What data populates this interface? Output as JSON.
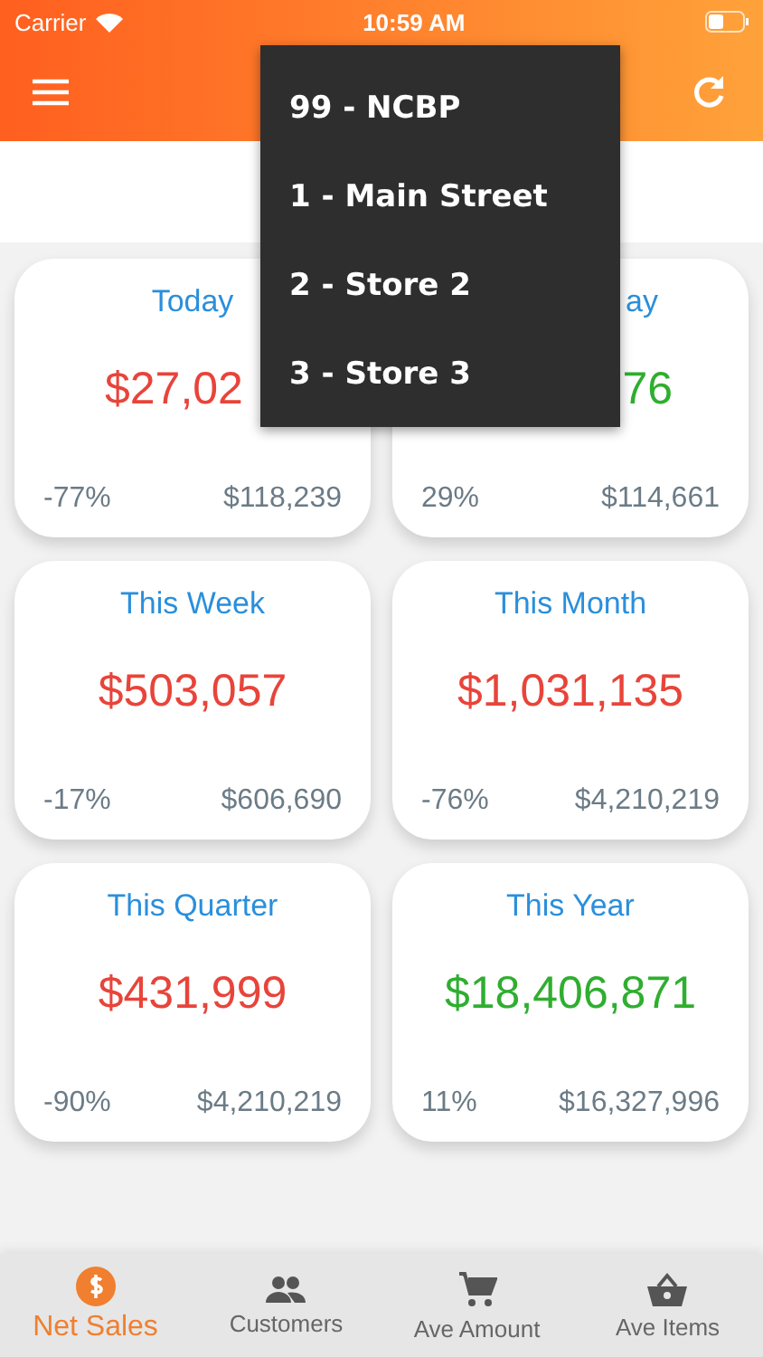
{
  "status_bar": {
    "carrier": "Carrier",
    "time": "10:59 AM"
  },
  "store_menu": {
    "items": [
      {
        "label": "99 - NCBP"
      },
      {
        "label": "1 - Main Street"
      },
      {
        "label": "2 - Store 2"
      },
      {
        "label": "3 - Store 3"
      }
    ]
  },
  "cards": [
    {
      "title": "Today",
      "amount": "$27,02",
      "color": "#e8443a",
      "change": "-77%",
      "previous": "$118,239"
    },
    {
      "title": "ay",
      "amount": "76",
      "color": "#2fae2f",
      "change": "29%",
      "previous": "$114,661"
    },
    {
      "title": "This Week",
      "amount": "$503,057",
      "color": "#e8443a",
      "change": "-17%",
      "previous": "$606,690"
    },
    {
      "title": "This Month",
      "amount": "$1,031,135",
      "color": "#e8443a",
      "change": "-76%",
      "previous": "$4,210,219"
    },
    {
      "title": "This Quarter",
      "amount": "$431,999",
      "color": "#e8443a",
      "change": "-90%",
      "previous": "$4,210,219"
    },
    {
      "title": "This Year",
      "amount": "$18,406,871",
      "color": "#2fae2f",
      "change": "11%",
      "previous": "$16,327,996"
    }
  ],
  "tabs": [
    {
      "label": "Net Sales",
      "selected": true
    },
    {
      "label": "Customers",
      "selected": false
    },
    {
      "label": "Ave Amount",
      "selected": false
    },
    {
      "label": "Ave Items",
      "selected": false
    }
  ]
}
